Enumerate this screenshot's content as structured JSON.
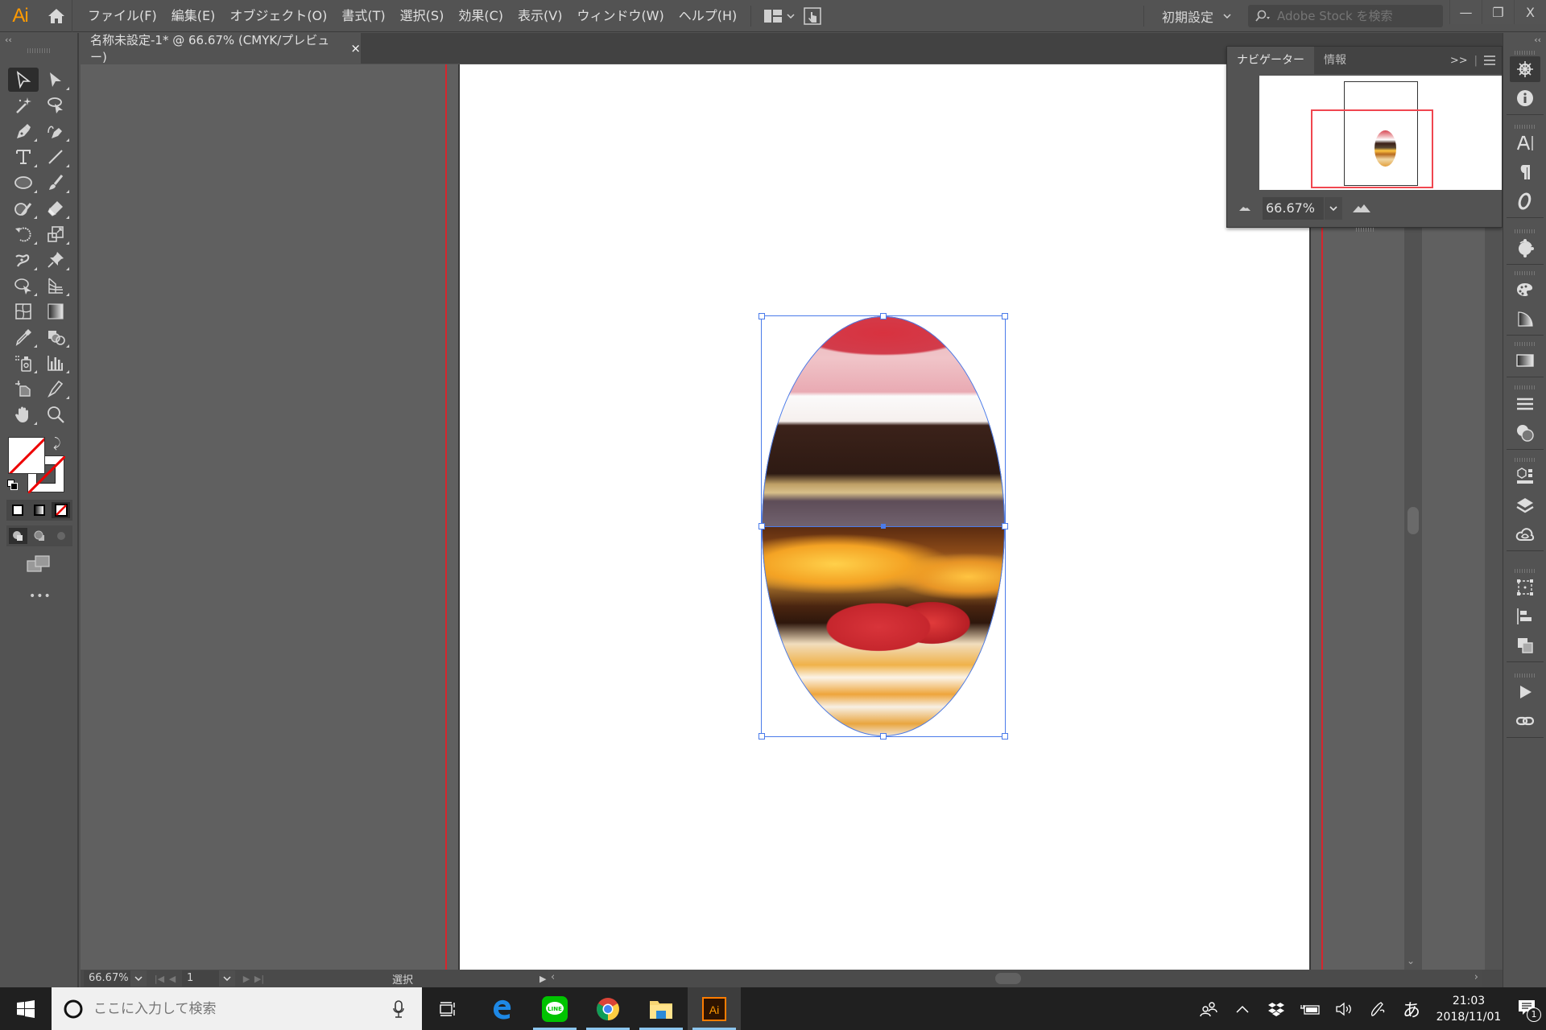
{
  "app": {
    "logo": "Ai",
    "menus": [
      "ファイル(F)",
      "編集(E)",
      "オブジェクト(O)",
      "書式(T)",
      "選択(S)",
      "効果(C)",
      "表示(V)",
      "ウィンドウ(W)",
      "ヘルプ(H)"
    ],
    "workspace": "初期設定",
    "stock_search_placeholder": "Adobe Stock を検索",
    "window_controls": {
      "minimize": "—",
      "restore": "❐",
      "close": "X"
    }
  },
  "document_tab": {
    "title": "名称未設定-1* @ 66.67% (CMYK/プレビュー)",
    "close": "×"
  },
  "toolbar": {
    "collapse": "‹‹",
    "tools": [
      "selection-tool",
      "direct-selection-tool",
      "magic-wand-tool",
      "lasso-tool",
      "pen-tool",
      "curvature-tool",
      "type-tool",
      "line-segment-tool",
      "ellipse-tool",
      "paintbrush-tool",
      "shaper-tool",
      "eraser-tool",
      "rotate-tool",
      "scale-tool",
      "puppet-warp-tool",
      "pin-tool",
      "free-transform-tool",
      "perspective-grid-tool",
      "mesh-tool",
      "gradient-tool",
      "eyedropper-tool",
      "shape-builder-tool",
      "symbol-sprayer-tool",
      "column-graph-tool",
      "artboard-tool",
      "slice-tool",
      "hand-tool",
      "zoom-tool"
    ],
    "fill": "none",
    "stroke": "none",
    "more": "•••"
  },
  "navigator": {
    "tabs": [
      "ナビゲーター",
      "情報"
    ],
    "active_tab": "ナビゲーター",
    "zoom": "66.67%"
  },
  "dock": {
    "collapse": "‹‹",
    "groups": [
      [
        "navigator-panel",
        "info-panel"
      ],
      [
        "character-panel",
        "paragraph-panel",
        "opentype-panel"
      ],
      [
        "color-guide-panel"
      ],
      [
        "swatches-panel",
        "color-panel"
      ],
      [
        "gradient-panel"
      ],
      [
        "stroke-panel",
        "transparency-panel"
      ],
      [
        "asset-export-panel",
        "layers-panel",
        "libraries-panel"
      ],
      [
        "transform-panel",
        "align-panel",
        "pathfinder-panel"
      ],
      [
        "actions-panel",
        "links-panel"
      ]
    ]
  },
  "artwork": {
    "shape": "ellipse clipping group",
    "top_image": "chocolate cake with pink mousse and cream",
    "bottom_image": "strawberry shortcake slice",
    "selection_color": "#4a7bea",
    "bleed_color": "#d6252d"
  },
  "statusbar": {
    "zoom": "66.67%",
    "artboard": "1",
    "current_tool": "選択"
  },
  "taskbar": {
    "search_placeholder": "ここに入力して検索",
    "apps": [
      "task-view",
      "edge",
      "line",
      "chrome",
      "file-explorer",
      "illustrator"
    ],
    "ime": "あ",
    "time": "21:03",
    "date": "2018/11/01",
    "notifications": "1"
  }
}
